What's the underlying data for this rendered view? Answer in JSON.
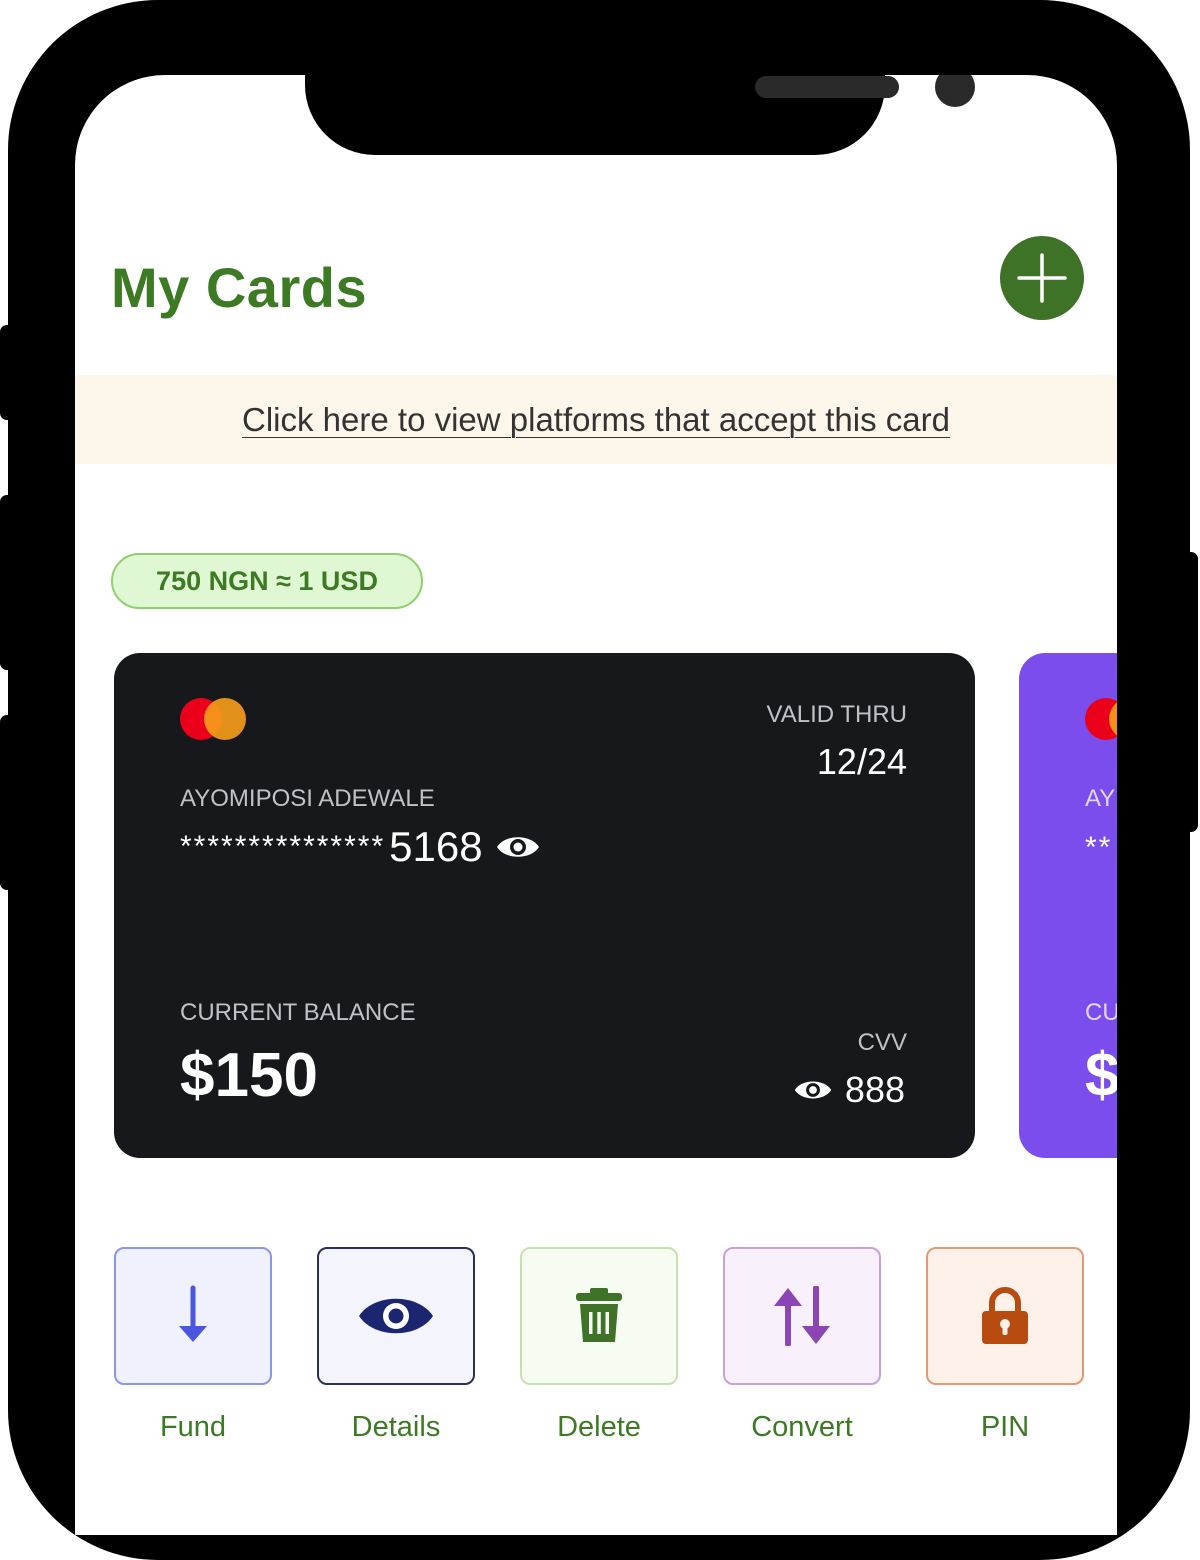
{
  "header": {
    "title": "My Cards",
    "add_icon": "plus-icon"
  },
  "banner": {
    "link_text": "Click here to view platforms that accept this card"
  },
  "exchange_rate": "750 NGN ≈ 1 USD",
  "cards": [
    {
      "brand_icon": "mastercard-logo",
      "valid_thru_label": "VALID THRU",
      "valid_thru": "12/24",
      "holder": "AYOMIPOSI ADEWALE",
      "number_mask": "***************",
      "number_last4": "5168",
      "balance_label": "CURRENT BALANCE",
      "balance": "$150",
      "cvv_label": "CVV",
      "cvv": "888",
      "colors": {
        "background": "#17181b"
      }
    },
    {
      "partial": true,
      "holder_visible": "AY",
      "number_visible": "**",
      "balance_label_visible": "CU",
      "balance_visible": "$",
      "colors": {
        "background": "#7b4ded"
      }
    }
  ],
  "actions": [
    {
      "label": "Fund",
      "icon": "arrow-down-icon",
      "color": "#4a55e0"
    },
    {
      "label": "Details",
      "icon": "eye-icon",
      "color": "#1c2670"
    },
    {
      "label": "Delete",
      "icon": "trash-icon",
      "color": "#3d7227"
    },
    {
      "label": "Convert",
      "icon": "swap-vertical-icon",
      "color": "#8b45b5"
    },
    {
      "label": "PIN",
      "icon": "lock-icon",
      "color": "#b84b10"
    }
  ],
  "colors": {
    "primary_green": "#3d7a24",
    "banner_bg": "#fdf7eb",
    "rate_pill_bg": "#e0f7d3",
    "rate_pill_border": "#8fcf6f"
  }
}
